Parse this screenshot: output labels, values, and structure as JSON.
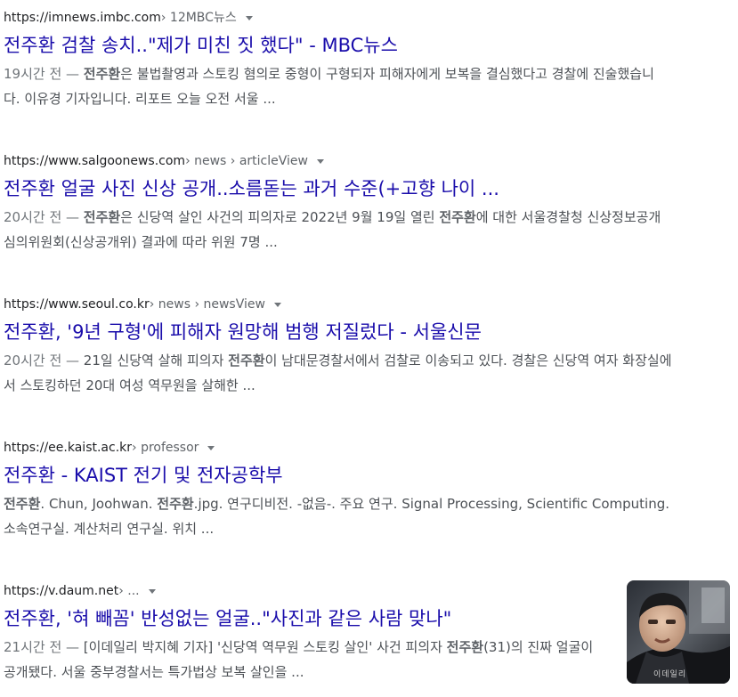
{
  "results": [
    {
      "domain": "https://imnews.imbc.com",
      "path": " › 12MBC뉴스",
      "title": "전주환 검찰 송치..\"제가 미친 짓 했다\" - MBC뉴스",
      "date": "19시간 전 — ",
      "snippet_parts": [
        {
          "text": "전주환",
          "bold": true
        },
        {
          "text": "은 불법촬영과 스토킹 혐의로 중형이 구형되자 피해자에게 보복을 결심했다고 경찰에 진술했습니다. 이유경 기자입니다. 리포트 오늘 오전 서울 ..."
        }
      ]
    },
    {
      "domain": "https://www.salgoonews.com",
      "path": " › news › articleView",
      "title": "전주환 얼굴 사진 신상 공개..소름돋는 과거 수준(+고향 나이 ...",
      "date": "20시간 전 — ",
      "snippet_parts": [
        {
          "text": "전주환",
          "bold": true
        },
        {
          "text": "은 신당역 살인 사건의 피의자로 2022년 9월 19일 열린 "
        },
        {
          "text": "전주환",
          "bold": true
        },
        {
          "text": "에 대한 서울경찰청 신상정보공개심의위원회(신상공개위) 결과에 따라 위원 7명 ..."
        }
      ]
    },
    {
      "domain": "https://www.seoul.co.kr",
      "path": " › news › newsView",
      "title": "전주환, '9년 구형'에 피해자 원망해 범행 저질렀다 - 서울신문",
      "date": "20시간 전 — ",
      "snippet_parts": [
        {
          "text": "21일 신당역 살해 피의자 "
        },
        {
          "text": "전주환",
          "bold": true
        },
        {
          "text": "이 남대문경찰서에서 검찰로 이송되고 있다. 경찰은 신당역 여자 화장실에서 스토킹하던 20대 여성 역무원을 살해한 ..."
        }
      ]
    },
    {
      "domain": "https://ee.kaist.ac.kr",
      "path": " › professor",
      "title": "전주환 - KAIST 전기 및 전자공학부",
      "date": "",
      "snippet_parts": [
        {
          "text": "전주환",
          "bold": true
        },
        {
          "text": ". Chun, Joohwan. "
        },
        {
          "text": "전주환",
          "bold": true
        },
        {
          "text": ".jpg. 연구디비전. -없음-. 주요 연구. Signal Processing, Scientific Computing. 소속연구실. 계산처리 연구실. 위치 ..."
        }
      ]
    },
    {
      "domain": "https://v.daum.net",
      "path": " › ...",
      "title": "전주환, '혀 빼꼼' 반성없는 얼굴..\"사진과 같은 사람 맞나\"",
      "date": "21시간 전 — ",
      "snippet_parts": [
        {
          "text": "[이데일리 박지혜 기자] '신당역 역무원 스토킹 살인' 사건 피의자 "
        },
        {
          "text": "전주환",
          "bold": true
        },
        {
          "text": "(31)의 진짜 얼굴이 공개됐다. 서울 중부경찰서는 특가법상 보복 살인을 ..."
        }
      ]
    }
  ],
  "thumbnail": {
    "watermark": "이데일리",
    "icon": "photo-thumbnail"
  },
  "colors": {
    "link": "#1a0dab",
    "cite": "#202124",
    "snippet": "#4d5156",
    "meta": "#70757a"
  }
}
